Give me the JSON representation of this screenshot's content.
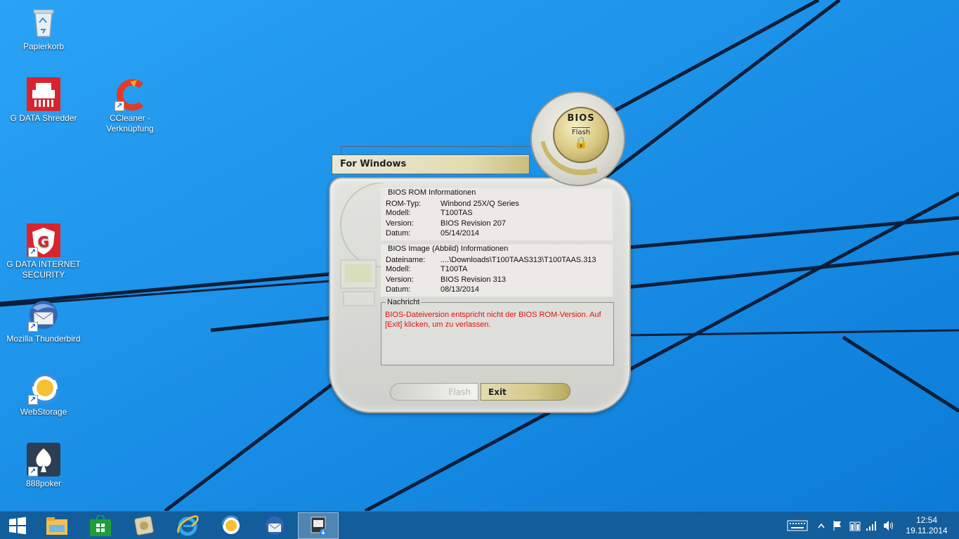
{
  "desktop_icons": [
    {
      "label": "Papierkorb",
      "icon": "recycle-bin-icon"
    },
    {
      "label": "G DATA Shredder",
      "icon": "gdata-shredder-icon"
    },
    {
      "label": "CCleaner - Verknüpfung",
      "icon": "ccleaner-icon"
    },
    {
      "label": "G DATA INTERNET SECURITY",
      "icon": "gdata-security-icon"
    },
    {
      "label": "Mozilla Thunderbird",
      "icon": "thunderbird-icon"
    },
    {
      "label": "WebStorage",
      "icon": "webstorage-icon"
    },
    {
      "label": "888poker",
      "icon": "poker-icon"
    }
  ],
  "bios_window": {
    "header": "For Windows",
    "badge_title": "BIOS",
    "badge_subtitle": "Flash",
    "rom_info": {
      "title": "BIOS ROM Informationen",
      "rows": [
        {
          "key": "ROM-Typ:",
          "value": "Winbond 25X/Q Series"
        },
        {
          "key": "Modell:",
          "value": "T100TAS"
        },
        {
          "key": "Version:",
          "value": "BIOS Revision 207"
        },
        {
          "key": "Datum:",
          "value": "05/14/2014"
        }
      ]
    },
    "image_info": {
      "title": "BIOS Image (Abbild) Informationen",
      "rows": [
        {
          "key": "Dateiname:",
          "value": "....\\Downloads\\T100TAAS313\\T100TAAS.313"
        },
        {
          "key": "Modell:",
          "value": "T100TA"
        },
        {
          "key": "Version:",
          "value": "BIOS Revision 313"
        },
        {
          "key": "Datum:",
          "value": "08/13/2014"
        }
      ]
    },
    "message": {
      "legend": "Nachricht",
      "text": "BIOS-Dateiversion entspricht nicht der BIOS ROM-Version. Auf [Exit] klicken, um zu verlassen."
    },
    "buttons": {
      "flash": "Flash",
      "exit": "Exit"
    }
  },
  "taskbar": {
    "items": [
      "start-button",
      "file-explorer",
      "store",
      "bios-tool-generic",
      "internet-explorer",
      "webstorage",
      "thunderbird",
      "bios-flash-active"
    ],
    "clock_time": "12:54",
    "clock_date": "19.11.2014"
  }
}
